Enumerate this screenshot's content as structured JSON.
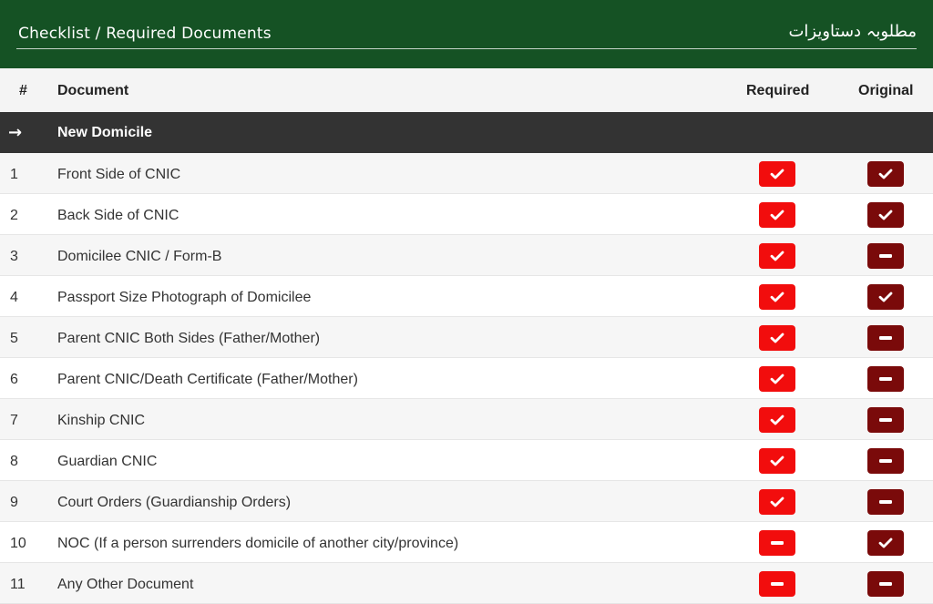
{
  "header": {
    "title": "Checklist / Required Documents",
    "urdu_title": "مطلوبہ دستاویزات"
  },
  "columns": {
    "num": "#",
    "document": "Document",
    "required": "Required",
    "original": "Original"
  },
  "section": {
    "arrow": "→",
    "label": "New Domicile"
  },
  "rows": [
    {
      "num": "1",
      "document": "Front Side of CNIC",
      "required": true,
      "original": true
    },
    {
      "num": "2",
      "document": "Back Side of CNIC",
      "required": true,
      "original": true
    },
    {
      "num": "3",
      "document": "Domicilee CNIC / Form-B",
      "required": true,
      "original": false
    },
    {
      "num": "4",
      "document": "Passport Size Photograph of Domicilee",
      "required": true,
      "original": true
    },
    {
      "num": "5",
      "document": "Parent CNIC Both Sides (Father/Mother)",
      "required": true,
      "original": false
    },
    {
      "num": "6",
      "document": "Parent CNIC/Death Certificate (Father/Mother)",
      "required": true,
      "original": false
    },
    {
      "num": "7",
      "document": "Kinship CNIC",
      "required": true,
      "original": false
    },
    {
      "num": "8",
      "document": "Guardian CNIC",
      "required": true,
      "original": false
    },
    {
      "num": "9",
      "document": "Court Orders (Guardianship Orders)",
      "required": true,
      "original": false
    },
    {
      "num": "10",
      "document": "NOC (If a person surrenders domicile of another city/province)",
      "required": false,
      "original": true
    },
    {
      "num": "11",
      "document": "Any Other Document",
      "required": false,
      "original": false
    }
  ],
  "colors": {
    "header_green": "#155224",
    "section_dark": "#333333",
    "required_red": "#f20d0d",
    "original_maroon": "#7a0a0a"
  },
  "icons": {
    "yes": "check-icon",
    "no": "minus-icon"
  }
}
